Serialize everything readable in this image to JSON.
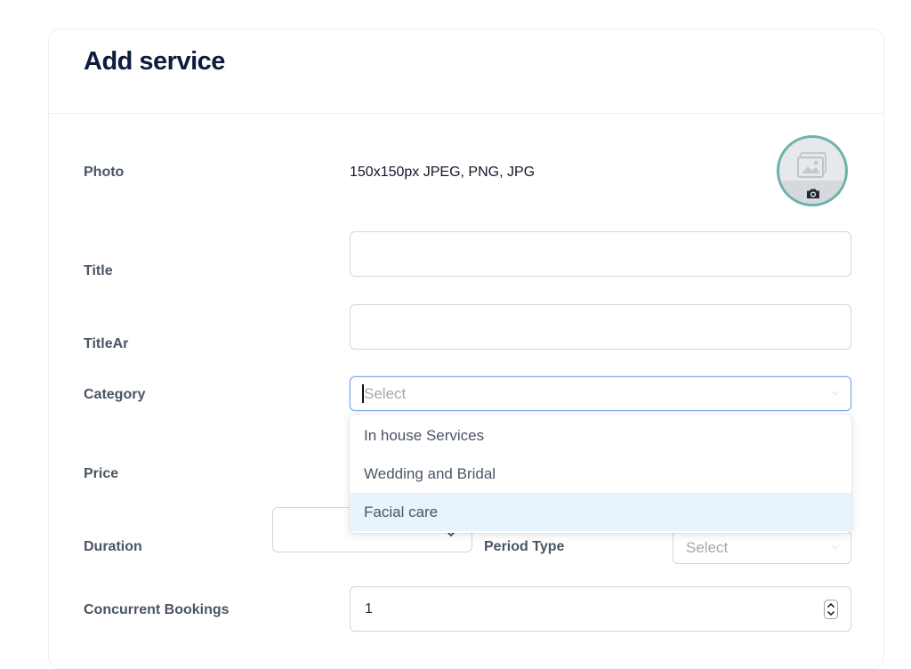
{
  "header": {
    "title": "Add service"
  },
  "photo": {
    "label": "Photo",
    "hint": "150x150px JPEG, PNG, JPG",
    "upload_icon": "image-placeholder-icon",
    "camera_icon": "camera-icon",
    "ring_color": "#6bb3a8"
  },
  "title_field": {
    "label": "Title",
    "value": ""
  },
  "title_ar_field": {
    "label": "TitleAr",
    "value": ""
  },
  "category": {
    "label": "Category",
    "placeholder": "Select",
    "options": [
      "In house Services",
      "Wedding and Bridal",
      "Facial care"
    ],
    "highlighted_option": "Facial care"
  },
  "price": {
    "label": "Price"
  },
  "duration": {
    "label": "Duration",
    "value": ""
  },
  "period_type": {
    "label": "Period Type",
    "placeholder": "Select"
  },
  "concurrent_bookings": {
    "label": "Concurrent Bookings",
    "value": "1"
  },
  "colors": {
    "focus_border": "#7aa9e8",
    "highlight_bg": "#e8f3fb",
    "title_color": "#0f1b3d"
  }
}
